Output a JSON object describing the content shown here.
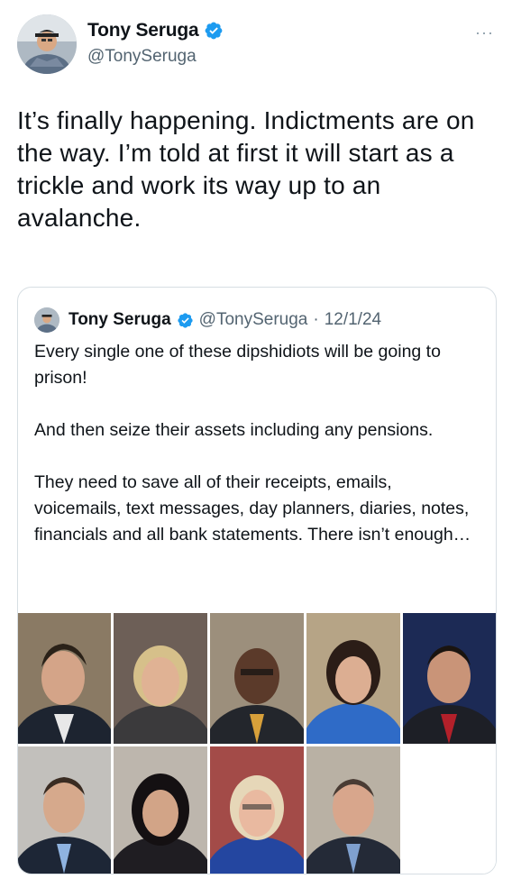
{
  "author": {
    "name": "Tony Seruga",
    "handle": "@TonySeruga",
    "verified_icon": "verified-badge-icon",
    "more_icon": "more-dots-icon",
    "more_label": "···"
  },
  "tweet": {
    "text": "It’s finally happening. Indictments are on the way. I’m told at first it will start as a trickle and work its way up to an avalanche."
  },
  "quote": {
    "name": "Tony Seruga",
    "handle": "@TonySeruga",
    "separator": "·",
    "date": "12/1/24",
    "paragraphs": [
      "Every single one of these dipshidiots will be going to prison!",
      "And then seize their assets including any pensions.",
      "They need to save all of their receipts, emails, voicemails, text messages, day planners, diaries, notes, financials and all bank statements. There isn’t enough…"
    ]
  },
  "colors": {
    "verified": "#1d9bf0",
    "secondary_text": "#536471",
    "border": "#d7dee3"
  }
}
